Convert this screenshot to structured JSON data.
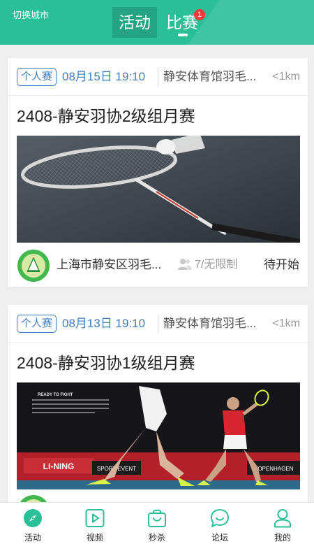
{
  "header": {
    "city_switch": "切换城市",
    "tabs": [
      {
        "label": "活动",
        "active": false
      },
      {
        "label": "比赛",
        "active": true,
        "badge": "1"
      }
    ]
  },
  "cards": [
    {
      "tag": "个人赛",
      "date": "08月15日 19:10",
      "venue": "静安体育馆羽毛...",
      "distance": "<1km",
      "title": "2408-静安羽协2级组月赛",
      "organizer": "上海市静安区羽毛...",
      "capacity": "7/无限制",
      "status": "待开始"
    },
    {
      "tag": "个人赛",
      "date": "08月13日 19:10",
      "venue": "静安体育馆羽毛...",
      "distance": "<1km",
      "title": "2408-静安羽协1级组月赛",
      "poster_text": "READY TO FIGHT",
      "ad_boards": [
        "LI-NING",
        "SPORT EVENT",
        "COPENHAGEN"
      ]
    }
  ],
  "nav": [
    {
      "label": "活动",
      "icon": "compass-icon",
      "active": true
    },
    {
      "label": "视频",
      "icon": "video-play-icon",
      "active": false
    },
    {
      "label": "秒杀",
      "icon": "shopping-bag-icon",
      "active": false
    },
    {
      "label": "论坛",
      "icon": "chat-bubble-icon",
      "active": false
    },
    {
      "label": "我的",
      "icon": "user-profile-icon",
      "active": false
    }
  ],
  "colors": {
    "brand": "#2bbf98",
    "accent_blue": "#3d7ec1",
    "badge_red": "#ef3b3b"
  }
}
